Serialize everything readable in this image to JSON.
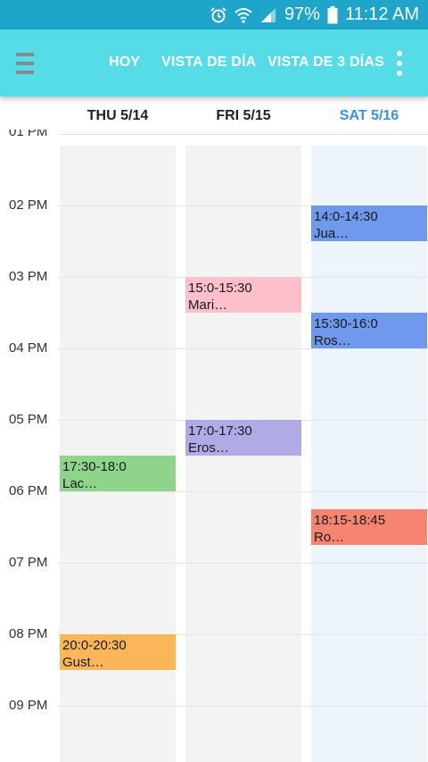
{
  "status_bar": {
    "battery": "97%",
    "time": "11:12 AM"
  },
  "toolbar": {
    "today_label": "HOY",
    "day_view_label": "VISTA DE DÍA",
    "three_day_label": "VISTA DE 3 DÍAS"
  },
  "days": [
    {
      "label": "THU 5/14"
    },
    {
      "label": "FRI 5/15"
    },
    {
      "label": "SAT 5/16",
      "is_today": true
    }
  ],
  "hours": [
    "01 PM",
    "02 PM",
    "03 PM",
    "04 PM",
    "05 PM",
    "06 PM",
    "07 PM",
    "08 PM",
    "09 PM"
  ],
  "events": [
    {
      "time": "17:30-18:0",
      "title": "Lac…",
      "color": "#8ed48a"
    },
    {
      "time": "20:0-20:30",
      "title": "Gust…",
      "color": "#fbb65a"
    },
    {
      "time": "15:0-15:30",
      "title": "Mari…",
      "color": "#fdbfcb"
    },
    {
      "time": "17:0-17:30",
      "title": "Eros…",
      "color": "#b0abe4"
    },
    {
      "time": "14:0-14:30",
      "title": "Jua…",
      "color": "#6e99ec"
    },
    {
      "time": "15:30-16:0",
      "title": "Ros…",
      "color": "#6e99ec"
    },
    {
      "time": "18:15-18:45",
      "title": "Ro…",
      "color": "#f78470"
    }
  ],
  "colors": {
    "status_bar": "#1ea5c9",
    "app_bar": "#55dce6",
    "today_accent": "#3a8fe8"
  }
}
